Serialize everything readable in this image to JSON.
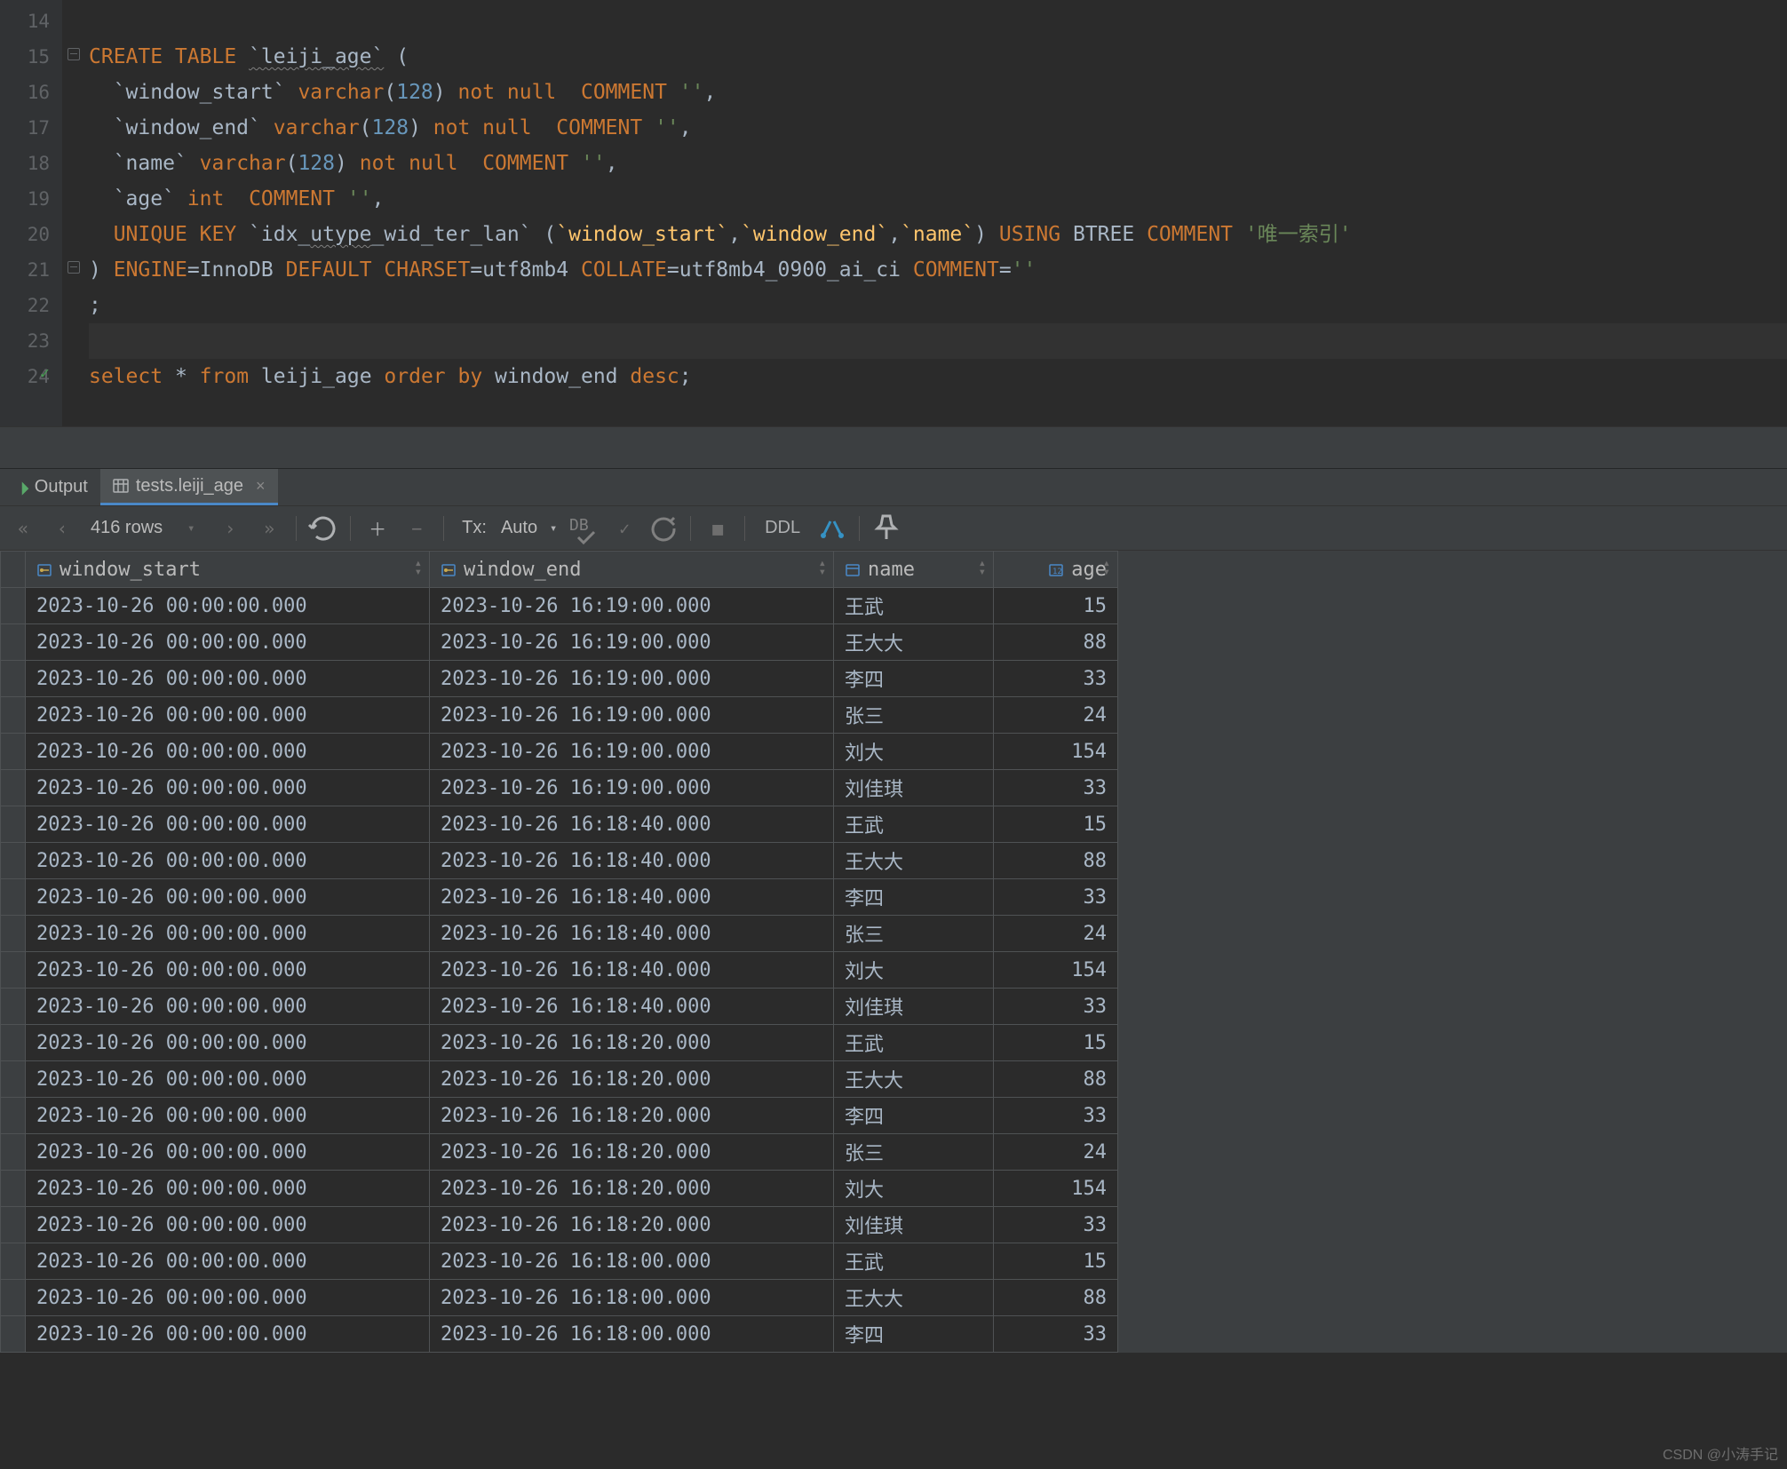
{
  "editor": {
    "first_line_no": 14,
    "lines": [
      {
        "n": 14,
        "html": ""
      },
      {
        "n": 15,
        "fold": "open",
        "html": "<span class='kw'>CREATE TABLE</span> <span class='id warn'>`leiji_age`</span> <span class='id'>(</span>"
      },
      {
        "n": 16,
        "html": "  <span class='id'>`window_start`</span> <span class='kw'>varchar</span><span class='id'>(</span><span class='num'>128</span><span class='id'>)</span> <span class='kw'>not null</span>  <span class='kw'>COMMENT</span> <span class='str'>''</span><span class='id'>,</span>"
      },
      {
        "n": 17,
        "html": "  <span class='id'>`window_end`</span> <span class='kw'>varchar</span><span class='id'>(</span><span class='num'>128</span><span class='id'>)</span> <span class='kw'>not null</span>  <span class='kw'>COMMENT</span> <span class='str'>''</span><span class='id'>,</span>"
      },
      {
        "n": 18,
        "html": "  <span class='id'>`name`</span> <span class='kw'>varchar</span><span class='id'>(</span><span class='num'>128</span><span class='id'>)</span> <span class='kw'>not null</span>  <span class='kw'>COMMENT</span> <span class='str'>''</span><span class='id'>,</span>"
      },
      {
        "n": 19,
        "html": "  <span class='id'>`age`</span> <span class='kw'>int</span>  <span class='kw'>COMMENT</span> <span class='str'>''</span><span class='id'>,</span>"
      },
      {
        "n": 20,
        "html": "  <span class='kw'>UNIQUE KEY</span> <span class='id'>`idx_<span class='warn'>utype</span>_wid_ter_lan`</span> <span class='id'>(</span><span class='ref'>`window_start`</span><span class='id'>,</span><span class='ref'>`window_end`</span><span class='id'>,</span><span class='ref'>`name`</span><span class='id'>)</span> <span class='kw'>USING</span> <span class='id'>BTREE</span> <span class='kw'>COMMENT</span> <span class='str'>'唯一索引'</span>"
      },
      {
        "n": 21,
        "fold": "close",
        "html": "<span class='id'>)</span> <span class='kw'>ENGINE</span><span class='id'>=InnoDB</span> <span class='kw'>DEFAULT CHARSET</span><span class='id'>=utf8mb4</span> <span class='kw'>COLLATE</span><span class='id'>=utf8mb4_0900_ai_ci</span> <span class='kw'>COMMENT</span><span class='id'>=</span><span class='str'>''</span>"
      },
      {
        "n": 22,
        "html": "<span class='id'>;</span>"
      },
      {
        "n": 23,
        "html": "",
        "caret": true
      },
      {
        "n": 24,
        "mark": "✓",
        "html": "<span class='kw'>select</span> <span class='id'>*</span> <span class='kw'>from</span> <span class='id'>leiji_age</span> <span class='kw'>order by</span> <span class='id'>window_end</span> <span class='kw'>desc</span><span class='id'>;</span>"
      }
    ]
  },
  "tabs": {
    "output": "Output",
    "active_tab": "tests.leiji_age"
  },
  "toolbar": {
    "row_count": "416 rows",
    "tx_label": "Tx:",
    "tx_mode": "Auto",
    "ddl": "DDL"
  },
  "columns": [
    {
      "key": "window_start",
      "label": "window_start",
      "icon": "pk"
    },
    {
      "key": "window_end",
      "label": "window_end",
      "icon": "pk"
    },
    {
      "key": "name",
      "label": "name",
      "icon": "col"
    },
    {
      "key": "age",
      "label": "age",
      "icon": "num",
      "align": "right"
    }
  ],
  "rows": [
    {
      "window_start": "2023-10-26 00:00:00.000",
      "window_end": "2023-10-26 16:19:00.000",
      "name": "王武",
      "age": 15
    },
    {
      "window_start": "2023-10-26 00:00:00.000",
      "window_end": "2023-10-26 16:19:00.000",
      "name": "王大大",
      "age": 88
    },
    {
      "window_start": "2023-10-26 00:00:00.000",
      "window_end": "2023-10-26 16:19:00.000",
      "name": "李四",
      "age": 33
    },
    {
      "window_start": "2023-10-26 00:00:00.000",
      "window_end": "2023-10-26 16:19:00.000",
      "name": "张三",
      "age": 24
    },
    {
      "window_start": "2023-10-26 00:00:00.000",
      "window_end": "2023-10-26 16:19:00.000",
      "name": "刘大",
      "age": 154
    },
    {
      "window_start": "2023-10-26 00:00:00.000",
      "window_end": "2023-10-26 16:19:00.000",
      "name": "刘佳琪",
      "age": 33
    },
    {
      "window_start": "2023-10-26 00:00:00.000",
      "window_end": "2023-10-26 16:18:40.000",
      "name": "王武",
      "age": 15
    },
    {
      "window_start": "2023-10-26 00:00:00.000",
      "window_end": "2023-10-26 16:18:40.000",
      "name": "王大大",
      "age": 88
    },
    {
      "window_start": "2023-10-26 00:00:00.000",
      "window_end": "2023-10-26 16:18:40.000",
      "name": "李四",
      "age": 33
    },
    {
      "window_start": "2023-10-26 00:00:00.000",
      "window_end": "2023-10-26 16:18:40.000",
      "name": "张三",
      "age": 24
    },
    {
      "window_start": "2023-10-26 00:00:00.000",
      "window_end": "2023-10-26 16:18:40.000",
      "name": "刘大",
      "age": 154
    },
    {
      "window_start": "2023-10-26 00:00:00.000",
      "window_end": "2023-10-26 16:18:40.000",
      "name": "刘佳琪",
      "age": 33
    },
    {
      "window_start": "2023-10-26 00:00:00.000",
      "window_end": "2023-10-26 16:18:20.000",
      "name": "王武",
      "age": 15
    },
    {
      "window_start": "2023-10-26 00:00:00.000",
      "window_end": "2023-10-26 16:18:20.000",
      "name": "王大大",
      "age": 88
    },
    {
      "window_start": "2023-10-26 00:00:00.000",
      "window_end": "2023-10-26 16:18:20.000",
      "name": "李四",
      "age": 33
    },
    {
      "window_start": "2023-10-26 00:00:00.000",
      "window_end": "2023-10-26 16:18:20.000",
      "name": "张三",
      "age": 24
    },
    {
      "window_start": "2023-10-26 00:00:00.000",
      "window_end": "2023-10-26 16:18:20.000",
      "name": "刘大",
      "age": 154
    },
    {
      "window_start": "2023-10-26 00:00:00.000",
      "window_end": "2023-10-26 16:18:20.000",
      "name": "刘佳琪",
      "age": 33
    },
    {
      "window_start": "2023-10-26 00:00:00.000",
      "window_end": "2023-10-26 16:18:00.000",
      "name": "王武",
      "age": 15
    },
    {
      "window_start": "2023-10-26 00:00:00.000",
      "window_end": "2023-10-26 16:18:00.000",
      "name": "王大大",
      "age": 88
    },
    {
      "window_start": "2023-10-26 00:00:00.000",
      "window_end": "2023-10-26 16:18:00.000",
      "name": "李四",
      "age": 33
    }
  ],
  "watermark": "CSDN @小涛手记"
}
